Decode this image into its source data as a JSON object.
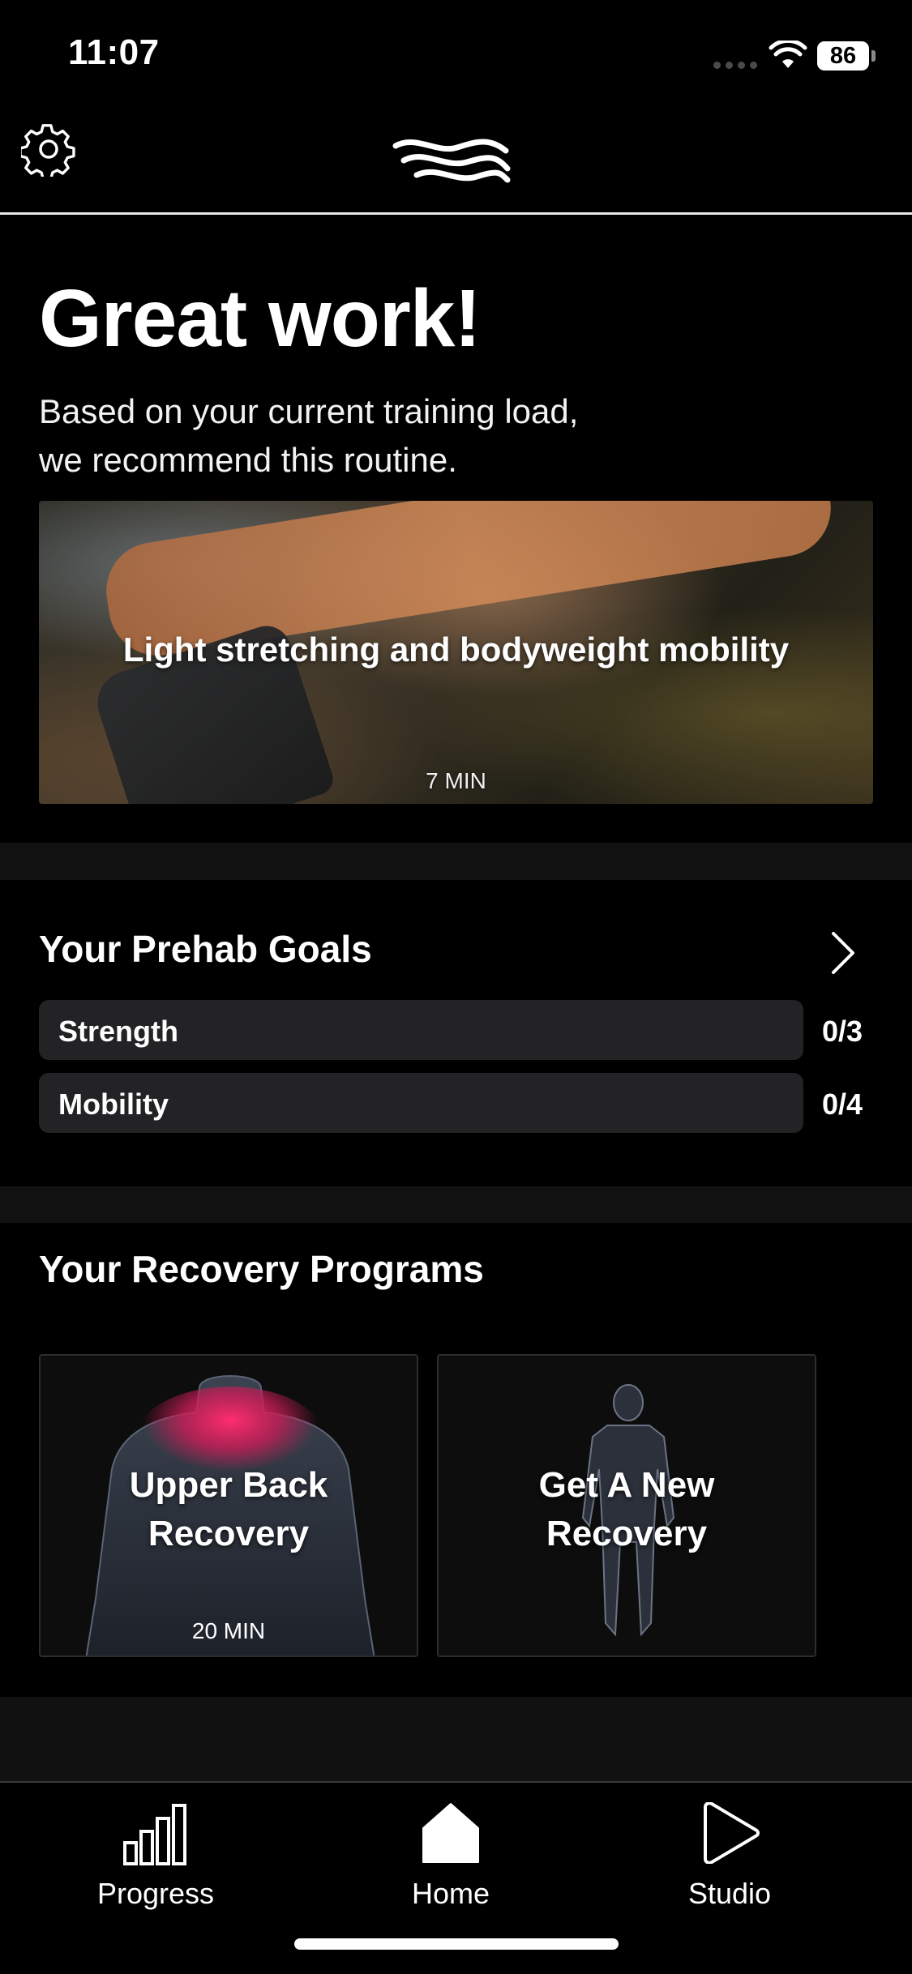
{
  "status_bar": {
    "time": "11:07",
    "battery": "86"
  },
  "hero": {
    "title": "Great work!",
    "subtitle_line1": "Based on your current training load,",
    "subtitle_line2": "we recommend this routine.",
    "routine": {
      "title": "Light stretching and bodyweight mobility",
      "duration": "7 MIN"
    }
  },
  "prehab": {
    "title": "Your Prehab Goals",
    "goals": [
      {
        "label": "Strength",
        "count": "0/3"
      },
      {
        "label": "Mobility",
        "count": "0/4"
      }
    ]
  },
  "recovery": {
    "title": "Your Recovery Programs",
    "programs": [
      {
        "title_line1": "Upper Back",
        "title_line2": "Recovery",
        "duration": "20 MIN"
      },
      {
        "title_line1": "Get A New",
        "title_line2": "Recovery"
      }
    ]
  },
  "tab_bar": {
    "tabs": [
      {
        "label": "Progress",
        "icon": "bar-chart-icon"
      },
      {
        "label": "Home",
        "icon": "home-icon"
      },
      {
        "label": "Studio",
        "icon": "play-icon"
      }
    ]
  },
  "colors": {
    "background": "#000000",
    "card": "#232326",
    "accent_heat": "#e0245e"
  }
}
